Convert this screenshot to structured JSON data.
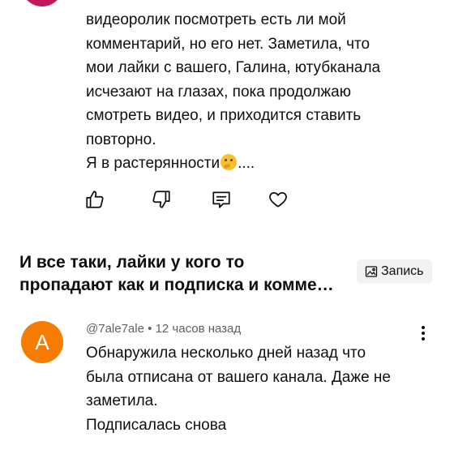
{
  "comment1": {
    "lines": [
      "видеоролик посмотреть есть ли мой",
      "комментарий, но его нет. Заметила, что",
      "мои лайки с вашего, Галина, ютубканала",
      "исчезают на глазах, пока продолжаю",
      "смотреть видео, и приходится ставить",
      "повторно."
    ],
    "last_line_before": "Я в растерянности",
    "last_line_after": "....",
    "emoji": "thinking-face"
  },
  "actions": {
    "like_icon": "thumbs-up-icon",
    "dislike_icon": "thumbs-down-icon",
    "reply_icon": "comment-icon",
    "heart_icon": "heart-icon"
  },
  "post": {
    "title_line1": "И все таки, лайки у кого то",
    "title_line2": "пропадают как и подписка и комме…",
    "record_label": "Запись",
    "record_icon": "image-icon"
  },
  "comment2": {
    "avatar_letter": "A",
    "avatar_color": "#f57c00",
    "author": "@7ale7ale",
    "separator": "•",
    "time": "12 часов назад",
    "lines": [
      "Обнаружила несколько дней назад что",
      "была отписана от вашего канала. Даже не",
      "заметила.",
      "Подписалась снова"
    ]
  }
}
